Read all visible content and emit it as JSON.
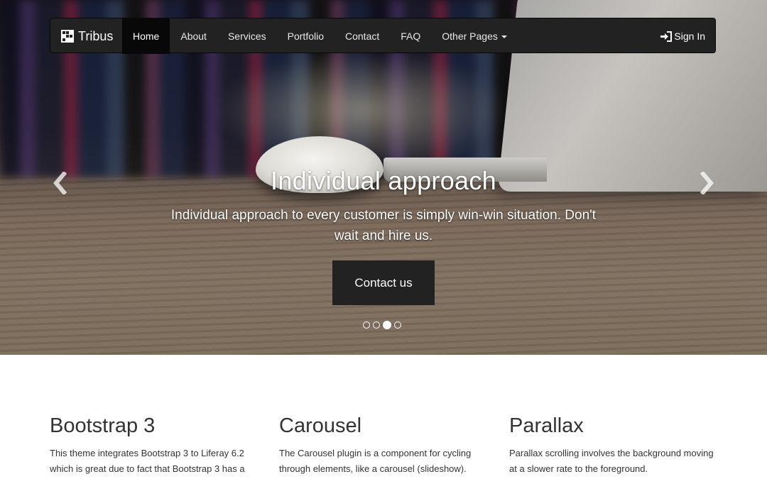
{
  "navbar": {
    "brand": "Tribus",
    "items": [
      {
        "label": "Home"
      },
      {
        "label": "About"
      },
      {
        "label": "Services"
      },
      {
        "label": "Portfolio"
      },
      {
        "label": "Contact"
      },
      {
        "label": "FAQ"
      },
      {
        "label": "Other Pages"
      }
    ],
    "active": "Home",
    "signin": "Sign In",
    "icons": {
      "brand": "grid-logo-icon",
      "signin": "sign-in-icon",
      "dropdown": "caret-down-icon"
    }
  },
  "carousel": {
    "title": "Individual approach",
    "text": "Individual approach to every customer is simply win-win situation. Don't wait and hire us.",
    "button": "Contact us",
    "slide_count": 4,
    "active_slide": 3,
    "controls": {
      "prev": "chevron-left-icon",
      "next": "chevron-right-icon"
    }
  },
  "features": [
    {
      "title": "Bootstrap 3",
      "text": "This theme integrates Bootstrap 3 to Liferay 6.2 which is great due to fact that Bootstrap 3 has a"
    },
    {
      "title": "Carousel",
      "text": "The Carousel plugin is a component for cycling through elements, like a carousel (slideshow)."
    },
    {
      "title": "Parallax",
      "text": "Parallax scrolling involves the background moving at a slower rate to the foreground."
    }
  ],
  "colors": {
    "navbar": "#222222",
    "active_nav": "#080808",
    "button": "#222222",
    "text": "#333333"
  }
}
